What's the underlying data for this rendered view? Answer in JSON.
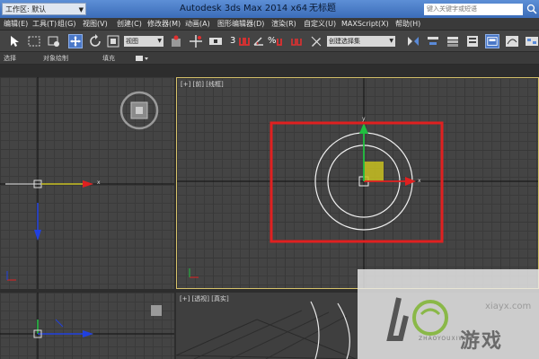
{
  "titlebar": {
    "workspace": "工作区: 默认",
    "app_title": "Autodesk 3ds Max  2014 x64",
    "doc_title": "无标题",
    "search_placeholder": "键入关键字或短语"
  },
  "menu": [
    "编辑(E)",
    "工具(T)",
    "组(G)",
    "视图(V)",
    "创建(C)",
    "修改器(M)",
    "动画(A)",
    "图形编辑器(D)",
    "渲染(R)",
    "自定义(U)",
    "MAXScript(X)",
    "帮助(H)"
  ],
  "toolbar": {
    "view_select": "视图",
    "selection_set": "创建选择集",
    "snap_labels": [
      "3",
      "%"
    ]
  },
  "ribbon": {
    "items": [
      "选择",
      "对象绘制",
      "填充"
    ]
  },
  "viewports": {
    "front_label": "[+] [前] [线框]",
    "persp_label": "[+] [透视] [真实]",
    "axis_x": "x",
    "axis_y": "y"
  },
  "watermark": {
    "url": "xiayx.com",
    "site": "ZHAOYOUXIWANG",
    "zh": "游戏"
  },
  "colors": {
    "highlight_box": "#e02020",
    "gizmo_x": "#e02020",
    "gizmo_y": "#20c040",
    "gizmo_z": "#2040e0",
    "gizmo_plane": "#c8c020",
    "titlebar": "#3b6cb8"
  }
}
